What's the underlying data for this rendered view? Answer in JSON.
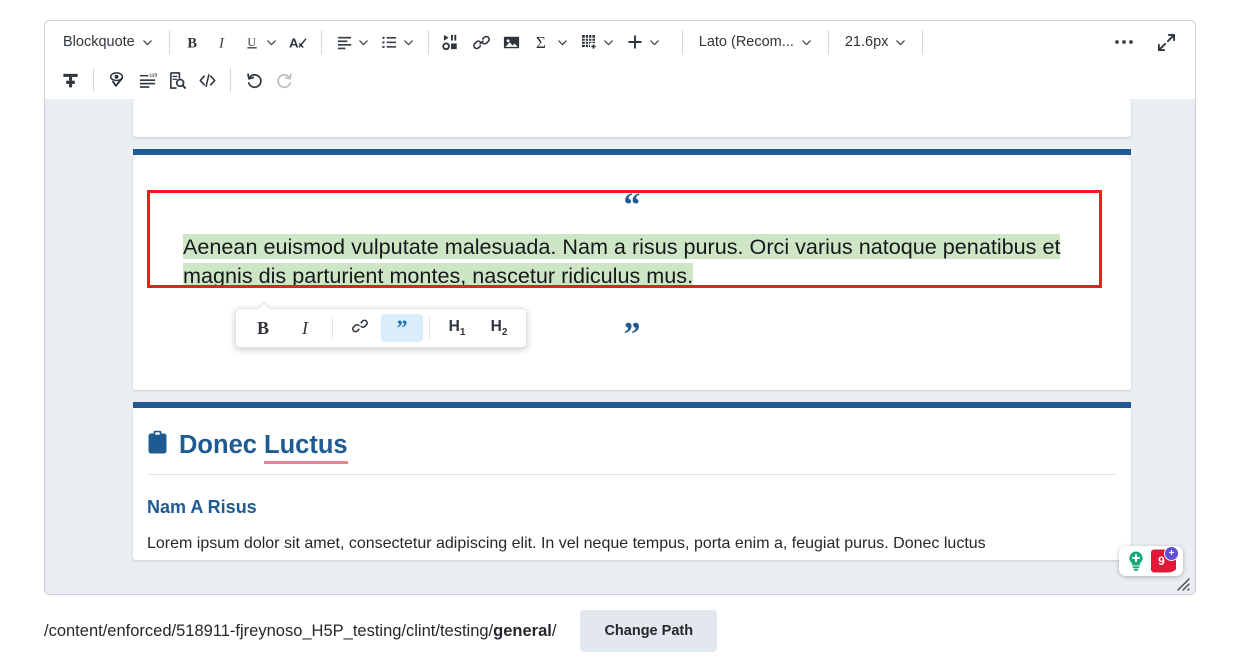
{
  "toolbar": {
    "row1": [
      {
        "type": "dropdown",
        "name": "paragraph-format-dropdown",
        "label": "Blockquote"
      },
      {
        "type": "sep"
      },
      {
        "type": "button",
        "name": "bold-button",
        "icon": "bold-icon",
        "label": "B"
      },
      {
        "type": "button",
        "name": "italic-button",
        "icon": "italic-icon",
        "label": "I"
      },
      {
        "type": "dropdown-icon",
        "name": "underline-button",
        "icon": "underline-icon",
        "label": "U"
      },
      {
        "type": "button",
        "name": "clear-formatting-button",
        "icon": "clear-formatting-icon",
        "label": "A"
      },
      {
        "type": "sep"
      },
      {
        "type": "dropdown-icon",
        "name": "align-button",
        "icon": "align-left-icon",
        "label": ""
      },
      {
        "type": "dropdown-icon",
        "name": "list-button",
        "icon": "bulleted-list-icon",
        "label": ""
      },
      {
        "type": "sep"
      },
      {
        "type": "button",
        "name": "insert-media-button",
        "icon": "media-icon",
        "label": ""
      },
      {
        "type": "button",
        "name": "insert-link-button",
        "icon": "link-icon",
        "label": ""
      },
      {
        "type": "button",
        "name": "insert-image-button",
        "icon": "image-icon",
        "label": ""
      },
      {
        "type": "dropdown-icon",
        "name": "insert-equation-button",
        "icon": "sigma-icon",
        "label": "Σ"
      },
      {
        "type": "dropdown-icon",
        "name": "insert-table-button",
        "icon": "table-icon",
        "label": ""
      },
      {
        "type": "dropdown-icon",
        "name": "insert-more-button",
        "icon": "plus-icon",
        "label": "+"
      }
    ],
    "font_family": "Lato (Recom...",
    "font_size": "21.6px",
    "more_options_label": "•••",
    "fullscreen_name": "fullscreen-icon",
    "row2": [
      {
        "name": "format-painter-button",
        "icon": "format-painter-icon"
      },
      {
        "sep": true
      },
      {
        "name": "accessibility-checker-button",
        "icon": "accessibility-eye-check-icon"
      },
      {
        "name": "word-count-button",
        "icon": "line-numbers-icon"
      },
      {
        "name": "preview-button",
        "icon": "document-search-icon"
      },
      {
        "name": "source-code-button",
        "icon": "code-icon"
      },
      {
        "sep": true
      },
      {
        "name": "undo-button",
        "icon": "undo-icon"
      },
      {
        "name": "redo-button",
        "icon": "redo-icon",
        "disabled": true
      }
    ]
  },
  "document": {
    "quote": {
      "open_mark": "“",
      "close_mark": "”",
      "highlighted_line_1": "Aenean euismod vulputate malesuada. Nam a risus purus. Orci varius natoque penatibus et",
      "highlighted_line_2": "magnis dis parturient montes, nascetur ridiculus mus.",
      "selection_outline_color": "#f31b1b",
      "highlight_color": "#cfe6c6"
    },
    "section": {
      "icon_name": "clipboard-icon",
      "heading_plain": "Donec ",
      "heading_underlined": "Luctus",
      "subheading": "Nam A Risus",
      "paragraph": "Lorem ipsum dolor sit amet, consectetur adipiscing elit. In vel neque tempus, porta enim a, feugiat purus. Donec luctus",
      "heading_color": "#1f5b92",
      "underline_color": "#ef8295"
    }
  },
  "bubble_toolbar": {
    "items": [
      {
        "name": "bubble-bold-button",
        "label": "B",
        "icon": "bold-icon",
        "active": false
      },
      {
        "name": "bubble-italic-button",
        "label": "I",
        "icon": "italic-icon",
        "active": false
      },
      {
        "sep": true
      },
      {
        "name": "bubble-link-button",
        "label": "",
        "icon": "link-icon",
        "active": false
      },
      {
        "name": "bubble-blockquote-button",
        "label": "”",
        "icon": "quote-icon",
        "active": true
      },
      {
        "sep": true
      },
      {
        "name": "bubble-heading1-button",
        "label": "H1",
        "icon": "heading-1-icon",
        "active": false
      },
      {
        "name": "bubble-heading2-button",
        "label": "H2",
        "icon": "heading-2-icon",
        "active": false
      }
    ],
    "active_color": "#d9edfb"
  },
  "accessibility_widget": {
    "bulb_icon": "lightbulb-plus-icon",
    "issue_count": "9",
    "plus_badge": "+",
    "shield_color": "#e31837",
    "bulb_color": "#18a97b",
    "plus_color": "#5e4edb"
  },
  "footer": {
    "path_prefix": "/content/enforced/518911-fjreynoso_H5P_testing/clint/testing/",
    "path_bold": "general",
    "path_suffix": "/",
    "change_path_label": "Change Path"
  }
}
